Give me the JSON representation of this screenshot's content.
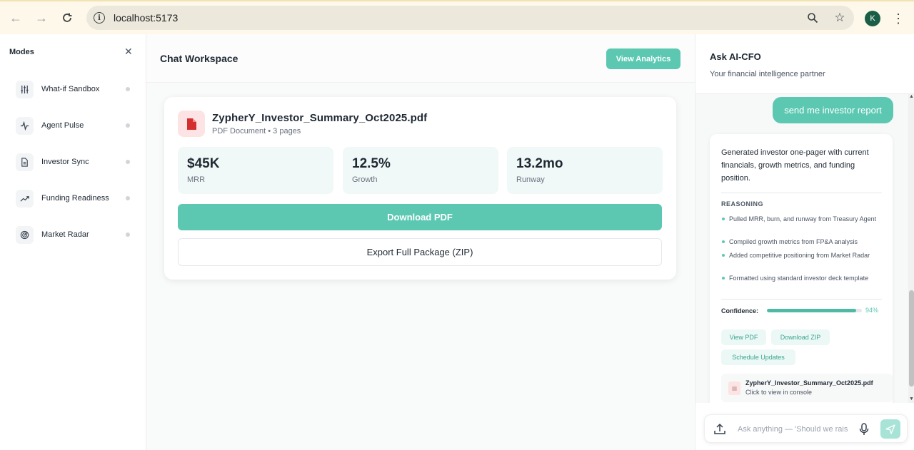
{
  "browser": {
    "url": "localhost:5173",
    "profile_initial": "K"
  },
  "sidebar": {
    "title": "Modes",
    "items": [
      {
        "label": "What-if Sandbox",
        "icon": "sliders-icon"
      },
      {
        "label": "Agent Pulse",
        "icon": "pulse-icon"
      },
      {
        "label": "Investor Sync",
        "icon": "document-icon"
      },
      {
        "label": "Funding Readiness",
        "icon": "trending-up-icon"
      },
      {
        "label": "Market Radar",
        "icon": "radar-icon"
      }
    ]
  },
  "main": {
    "title": "Chat Workspace",
    "analytics_button": "View Analytics",
    "document": {
      "name": "ZypherY_Investor_Summary_Oct2025.pdf",
      "meta": "PDF Document • 3 pages",
      "stats": [
        {
          "value": "$45K",
          "label": "MRR"
        },
        {
          "value": "12.5%",
          "label": "Growth"
        },
        {
          "value": "13.2mo",
          "label": "Runway"
        }
      ],
      "download_button": "Download PDF",
      "export_button": "Export Full Package (ZIP)"
    }
  },
  "right_panel": {
    "title": "Ask AI-CFO",
    "subtitle": "Your financial intelligence partner",
    "user_message": "send me investor report",
    "bot": {
      "text": "Generated investor one-pager with current financials, growth metrics, and funding position.",
      "reasoning_title": "REASONING",
      "reasoning": [
        "Pulled MRR, burn, and runway from Treasury Agent",
        "Compiled growth metrics from FP&A analysis",
        "Added competitive positioning from Market Radar",
        "Formatted using standard investor deck template"
      ],
      "confidence_label": "Confidence:",
      "confidence_value": "94%",
      "confidence_fraction": 0.94,
      "actions": [
        "View PDF",
        "Download ZIP",
        "Schedule Updates"
      ],
      "file_name": "ZypherY_Investor_Summary_Oct2025.pdf",
      "file_hint": "Click to view in console"
    },
    "input_placeholder": "Ask anything — 'Should we raise now?'"
  },
  "colors": {
    "accent": "#5cc8b2",
    "accent_light": "#ecf8f5",
    "pdf_red": "#d32f2f"
  }
}
